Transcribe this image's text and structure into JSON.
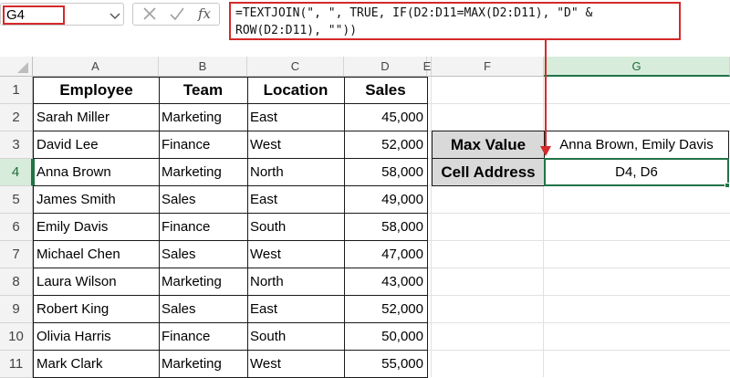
{
  "name_box": {
    "value": "G4"
  },
  "formula_bar": {
    "cancel_icon": "×",
    "confirm_icon": "✓",
    "fx_label": "fx",
    "line1": "=TEXTJOIN(\", \", TRUE, IF(D2:D11=MAX(D2:D11), \"D\" &",
    "line2": "ROW(D2:D11), \"\"))"
  },
  "columns": [
    "A",
    "B",
    "C",
    "D",
    "E",
    "F",
    "G"
  ],
  "rows": [
    "1",
    "2",
    "3",
    "4",
    "5",
    "6",
    "7",
    "8",
    "9",
    "10",
    "11"
  ],
  "table": {
    "headers": [
      "Employee",
      "Team",
      "Location",
      "Sales"
    ],
    "rows": [
      [
        "Sarah Miller",
        "Marketing",
        "East",
        "45,000"
      ],
      [
        "David Lee",
        "Finance",
        "West",
        "52,000"
      ],
      [
        "Anna Brown",
        "Marketing",
        "North",
        "58,000"
      ],
      [
        "James Smith",
        "Sales",
        "East",
        "49,000"
      ],
      [
        "Emily Davis",
        "Finance",
        "South",
        "58,000"
      ],
      [
        "Michael Chen",
        "Sales",
        "West",
        "47,000"
      ],
      [
        "Laura Wilson",
        "Marketing",
        "North",
        "43,000"
      ],
      [
        "Robert King",
        "Sales",
        "East",
        "52,000"
      ],
      [
        "Olivia Harris",
        "Finance",
        "South",
        "50,000"
      ],
      [
        "Mark Clark",
        "Marketing",
        "West",
        "55,000"
      ]
    ]
  },
  "result": {
    "max_label": "Max Value",
    "max_value": "Anna Brown, Emily Davis",
    "addr_label": "Cell Address",
    "addr_value": "D4, D6"
  },
  "colors": {
    "accent_red": "#d42a2a",
    "excel_green": "#217346"
  }
}
